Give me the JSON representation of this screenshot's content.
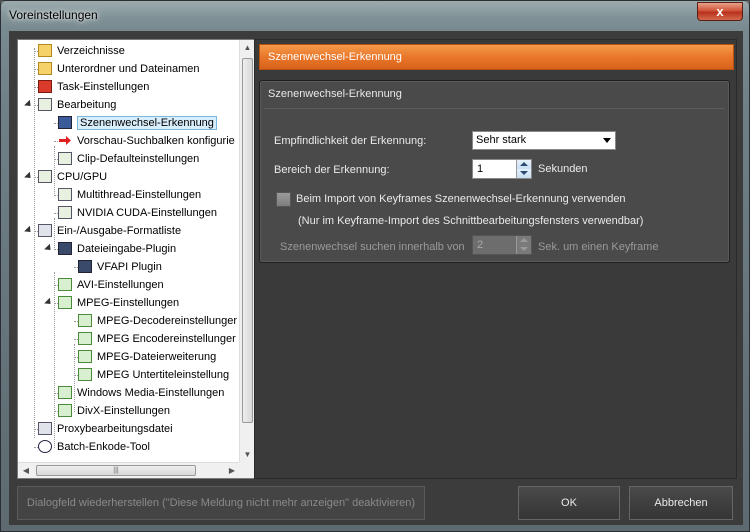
{
  "window": {
    "title": "Voreinstellungen",
    "close_glyph": "x"
  },
  "tree": {
    "items": [
      {
        "label": "Verzeichnisse",
        "icon": "folder-icon"
      },
      {
        "label": "Unterordner und Dateinamen",
        "icon": "folder-icon"
      },
      {
        "label": "Task-Einstellungen",
        "icon": "task-icon"
      },
      {
        "label": "Bearbeitung",
        "icon": "edit-icon"
      },
      {
        "label": "Szenenwechsel-Erkennung",
        "icon": "scene-detect-icon",
        "selected": true
      },
      {
        "label": "Vorschau-Suchbalken konfigurie",
        "icon": "red-arrow-icon"
      },
      {
        "label": "Clip-Defaulteinstellungen",
        "icon": "edit-icon"
      },
      {
        "label": "CPU/GPU",
        "icon": "edit-icon"
      },
      {
        "label": "Multithread-Einstellungen",
        "icon": "edit-icon"
      },
      {
        "label": "NVIDIA CUDA-Einstellungen",
        "icon": "edit-icon"
      },
      {
        "label": "Ein-/Ausgabe-Formatliste",
        "icon": "list-icon"
      },
      {
        "label": "Dateieingabe-Plugin",
        "icon": "plugin-icon"
      },
      {
        "label": "VFAPI Plugin",
        "icon": "plugin-icon"
      },
      {
        "label": "AVI-Einstellungen",
        "icon": "doc-icon"
      },
      {
        "label": "MPEG-Einstellungen",
        "icon": "doc-icon"
      },
      {
        "label": "MPEG-Decodereinstellunger",
        "icon": "doc-icon"
      },
      {
        "label": "MPEG Encodereinstellunger",
        "icon": "doc-icon"
      },
      {
        "label": "MPEG-Dateierweiterung",
        "icon": "doc-icon"
      },
      {
        "label": "MPEG Untertiteleinstellung",
        "icon": "doc-icon"
      },
      {
        "label": "Windows Media-Einstellungen",
        "icon": "doc-icon"
      },
      {
        "label": "DivX-Einstellungen",
        "icon": "doc-icon"
      },
      {
        "label": "Proxybearbeitungsdatei",
        "icon": "list-icon"
      },
      {
        "label": "Batch-Enkode-Tool",
        "icon": "clock-icon"
      }
    ]
  },
  "panel": {
    "header": "Szenenwechsel-Erkennung",
    "group_title": "Szenenwechsel-Erkennung",
    "sensitivity_label": "Empfindlichkeit der Erkennung:",
    "sensitivity_value": "Sehr stark",
    "range_label": "Bereich der Erkennung:",
    "range_value": "1",
    "range_unit": "Sekunden",
    "keyframe_checkbox_label": "Beim Import von Keyframes Szenenwechsel-Erkennung verwenden",
    "keyframe_note": "(Nur im Keyframe-Import des Schnittbearbeitungsfensters verwendbar)",
    "search_within_label": "Szenenwechsel suchen innerhalb von",
    "search_within_value": "2",
    "search_within_unit": "Sek. um einen Keyframe"
  },
  "buttons": {
    "restore_dialogs": "Dialogfeld wiederherstellen (\"Diese Meldung nicht mehr anzeigen\" deaktivieren)",
    "ok": "OK",
    "cancel": "Abbrechen"
  },
  "colors": {
    "accent": "#e9772a",
    "selected": "#d9eefb"
  }
}
